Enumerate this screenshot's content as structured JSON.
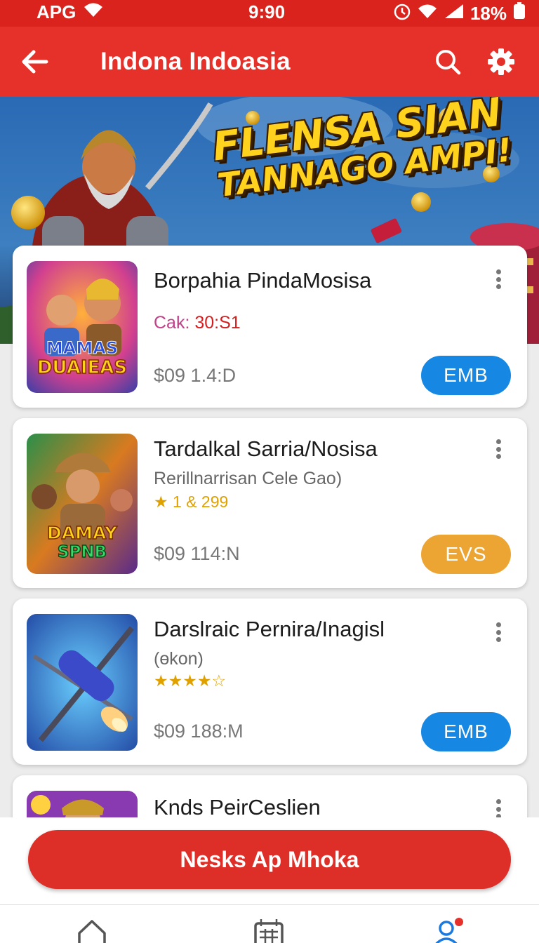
{
  "status_bar": {
    "carrier": "APG",
    "time": "9:90",
    "battery": "18%"
  },
  "app_bar": {
    "title": "Indona Indoasia"
  },
  "hero": {
    "line1": "FLENSA SIAN",
    "line2": "TANNAGO AMPI!"
  },
  "list": {
    "items": [
      {
        "title": "Borpahia PindaMosisa",
        "subtitle_label": "Cak:",
        "subtitle_value": "30:S1",
        "price": "$09  1.4:D",
        "badge": "EMB",
        "badge_color": "#1688e3",
        "thumb_text_1": "MAMAS",
        "thumb_text_2": "DUAIEAS"
      },
      {
        "title": "Tardalkal Sarria/Nosisa",
        "subtitle": "Rerillnarrisan Cele Gao)",
        "rating": "★ 1 & 299",
        "price": "$09  114:N",
        "badge": "EVS",
        "badge_color": "#eca533",
        "thumb_text_1": "DAMAY",
        "thumb_text_2": "SPNB"
      },
      {
        "title": "Darslraic Pernira/Inagisl",
        "subtitle": "(ɵkon)",
        "rating": "★★★★☆",
        "price": "$09  188:M",
        "badge": "EMB",
        "badge_color": "#1688e3"
      },
      {
        "title": "Knds PeirCeslien"
      }
    ]
  },
  "cta": {
    "label": "Nesks Ap Mhoka"
  }
}
